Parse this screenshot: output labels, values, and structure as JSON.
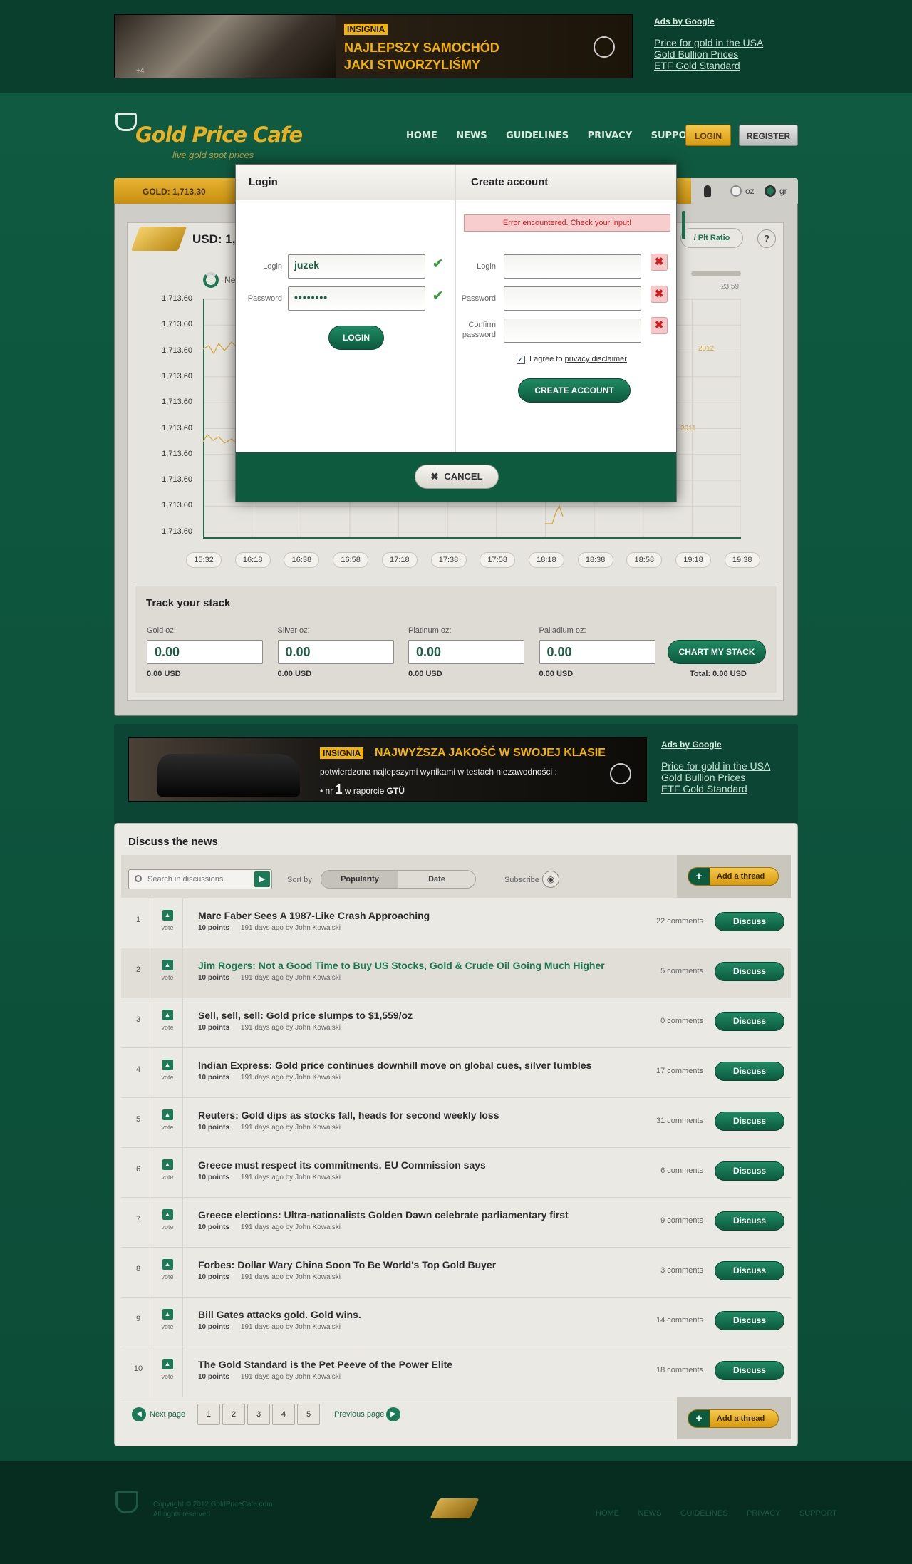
{
  "ads_top": {
    "brand": "INSIGNIA",
    "headline_line1": "NAJLEPSZY SAMOCHÓD",
    "headline_line2": "JAKI STWORZYLIŚMY",
    "plus": "+4",
    "ads_by": "Ads by Google",
    "links": [
      "Price for gold in the USA",
      "Gold Bullion Prices",
      "ETF Gold Standard"
    ]
  },
  "header": {
    "logo_text": "Gold Price Cafe",
    "tagline": "live gold spot prices",
    "nav": [
      "HOME",
      "NEWS",
      "GUIDELINES",
      "PRIVACY",
      "SUPPORT"
    ],
    "login_label": "LOGIN",
    "register_label": "REGISTER"
  },
  "chart_panel": {
    "gold_price": "GOLD: 1,713.30",
    "usd_label": "USD: 1,",
    "ratio_label": "/ Plt Ratio",
    "help": "?",
    "oz_label": "oz",
    "gr_label": "gr",
    "time_label": "23:59",
    "year_a": "2012",
    "year_b": "2011",
    "ne_label": "Ne"
  },
  "chart_data": {
    "type": "line",
    "y_ticks": [
      "1,713.60",
      "1,713.60",
      "1,713.60",
      "1,713.60",
      "1,713.60",
      "1,713.60",
      "1,713.60",
      "1,713.60",
      "1,713.60",
      "1,713.60"
    ],
    "x": [
      "15:32",
      "16:18",
      "16:38",
      "16:58",
      "17:18",
      "17:38",
      "17:58",
      "18:18",
      "18:38",
      "18:58",
      "19:18",
      "19:38"
    ],
    "grid": true
  },
  "track": {
    "title": "Track your stack",
    "fields": [
      {
        "label": "Gold oz:",
        "value": "0.00",
        "usd": "0.00 USD"
      },
      {
        "label": "Silver oz:",
        "value": "0.00",
        "usd": "0.00 USD"
      },
      {
        "label": "Platinum oz:",
        "value": "0.00",
        "usd": "0.00 USD"
      },
      {
        "label": "Palladium oz:",
        "value": "0.00",
        "usd": "0.00 USD"
      }
    ],
    "button": "CHART MY STACK",
    "total": "Total: 0.00 USD"
  },
  "ads_mid": {
    "brand": "INSIGNIA",
    "headline": "NAJWYŻSZA JAKOŚĆ W SWOJEJ KLASIE",
    "line2": "potwierdzona najlepszymi wynikami w testach niezawodności :",
    "line3_prefix": "• nr",
    "line3_num": "1",
    "line3_rest": "w raporcie",
    "line3_end": "GTÜ",
    "ads_by": "Ads by Google",
    "links": [
      "Price for gold in the USA",
      "Gold Bullion Prices",
      "ETF Gold Standard"
    ]
  },
  "discuss": {
    "title": "Discuss the news",
    "search_placeholder": "Search in discussions",
    "sort_by": "Sort by",
    "sort_popularity": "Popularity",
    "sort_date": "Date",
    "subscribe": "Subscribe",
    "add_thread": "Add a thread",
    "vote": "vote",
    "discuss_btn": "Discuss",
    "threads": [
      {
        "n": "1",
        "title": "Marc Faber Sees A 1987-Like Crash Approaching",
        "points": "10 points",
        "meta": "191 days ago by John Kowalski",
        "comments": "22 comments"
      },
      {
        "n": "2",
        "title": "Jim Rogers: Not a Good Time to Buy US Stocks, Gold & Crude Oil Going Much Higher",
        "points": "10 points",
        "meta": "191 days ago by John Kowalski",
        "comments": "5 comments"
      },
      {
        "n": "3",
        "title": "Sell, sell, sell: Gold price slumps to $1,559/oz",
        "points": "10 points",
        "meta": "191 days ago by John Kowalski",
        "comments": "0 comments"
      },
      {
        "n": "4",
        "title": "Indian Express: Gold price continues downhill move on global cues, silver tumbles",
        "points": "10 points",
        "meta": "191 days ago by John Kowalski",
        "comments": "17 comments"
      },
      {
        "n": "5",
        "title": "Reuters: Gold dips as stocks fall, heads for second weekly loss",
        "points": "10 points",
        "meta": "191 days ago by John Kowalski",
        "comments": "31 comments"
      },
      {
        "n": "6",
        "title": "Greece must respect its commitments, EU Commission says",
        "points": "10 points",
        "meta": "191 days ago by John Kowalski",
        "comments": "6 comments"
      },
      {
        "n": "7",
        "title": "Greece elections: Ultra-nationalists Golden Dawn celebrate parliamentary first",
        "points": "10 points",
        "meta": "191 days ago by John Kowalski",
        "comments": "9 comments"
      },
      {
        "n": "8",
        "title": "Forbes: Dollar Wary China Soon To Be World's Top Gold Buyer",
        "points": "10 points",
        "meta": "191 days ago by John Kowalski",
        "comments": "3 comments"
      },
      {
        "n": "9",
        "title": "Bill Gates attacks gold. Gold wins.",
        "points": "10 points",
        "meta": "191 days ago by John Kowalski",
        "comments": "14 comments"
      },
      {
        "n": "10",
        "title": "The Gold Standard is the Pet Peeve of the Power Elite",
        "points": "10 points",
        "meta": "191 days ago by John Kowalski",
        "comments": "18 comments"
      }
    ],
    "next_page": "Next page",
    "prev_page": "Previous page",
    "pages": [
      "1",
      "2",
      "3",
      "4",
      "5"
    ]
  },
  "footer": {
    "copyright": "Copyright © 2012 GoldPriceCafe.com",
    "rights": "All rights reserved",
    "nav": [
      "HOME",
      "NEWS",
      "GUIDELINES",
      "PRIVACY",
      "SUPPORT"
    ]
  },
  "modal": {
    "login_title": "Login",
    "create_title": "Create account",
    "login_label": "Login",
    "password_label": "Password",
    "login_value": "juzek",
    "password_value": "••••••••",
    "login_button": "LOGIN",
    "error": "Error encountered. Check your input!",
    "c_login_label": "Login",
    "c_password_label": "Password",
    "c_confirm_label_1": "Confirm",
    "c_confirm_label_2": "password",
    "agree_prefix": "I agree to",
    "agree_link": "privacy disclaimer",
    "create_button": "CREATE ACCOUNT",
    "cancel": "CANCEL"
  }
}
